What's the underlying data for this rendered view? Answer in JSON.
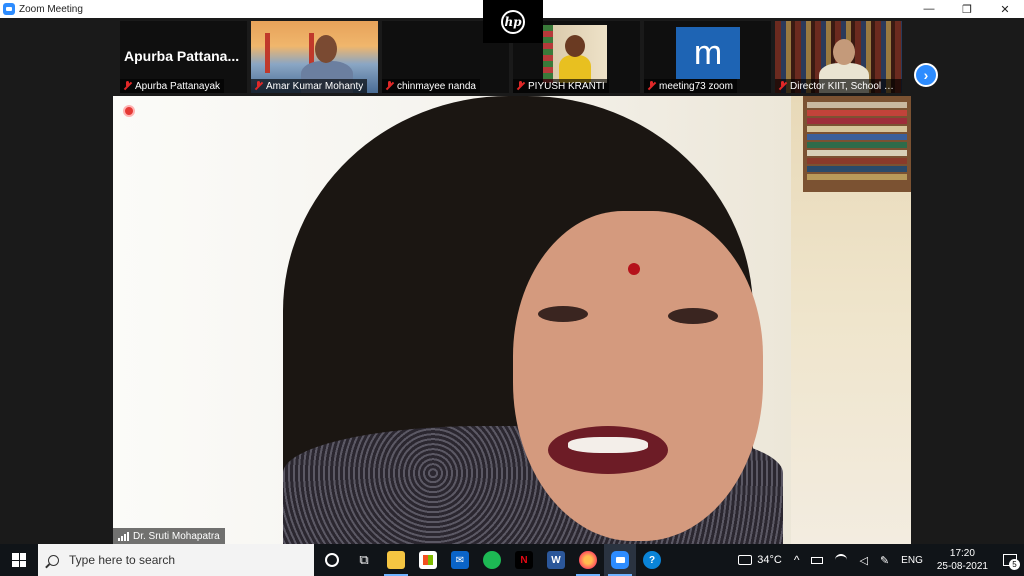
{
  "window": {
    "title": "Zoom Meeting",
    "minimize": "—",
    "restore": "❐",
    "close": "✕"
  },
  "hp_logo": "hp",
  "participants": [
    {
      "display": "name",
      "big_name": "Apurba  Pattana...",
      "name": "Apurba Pattanayak"
    },
    {
      "display": "video",
      "name": "Amar Kumar Mohanty"
    },
    {
      "display": "blank",
      "name": "chinmayee nanda"
    },
    {
      "display": "video",
      "name": "PIYUSH KRANTI"
    },
    {
      "display": "avatar",
      "avatar_letter": "m",
      "name": "meeting73 zoom"
    },
    {
      "display": "video",
      "name": "Director KIIT, School of..."
    }
  ],
  "next_page_icon": "chevron-right-icon",
  "main_speaker": {
    "name": "Dr. Sruti Mohapatra"
  },
  "taskbar": {
    "search_placeholder": "Type here to search",
    "apps": [
      {
        "name": "cortana-icon",
        "label": "O"
      },
      {
        "name": "task-view-icon",
        "label": "⧉"
      },
      {
        "name": "file-explorer-icon",
        "label": ""
      },
      {
        "name": "store-icon",
        "label": ""
      },
      {
        "name": "mail-icon",
        "label": "✉"
      },
      {
        "name": "spotify-icon",
        "label": ""
      },
      {
        "name": "netflix-icon",
        "label": "N"
      },
      {
        "name": "word-icon",
        "label": "W"
      },
      {
        "name": "firefox-icon",
        "label": ""
      },
      {
        "name": "zoom-icon",
        "label": ""
      },
      {
        "name": "help-icon",
        "label": "?"
      }
    ],
    "weather": "34°C",
    "language": "ENG",
    "time": "17:20",
    "date": "25-08-2021",
    "notification_count": "5"
  },
  "colors": {
    "zoom_blue": "#2d8cff",
    "muted_red": "#e02828",
    "taskbar": "#101418"
  }
}
